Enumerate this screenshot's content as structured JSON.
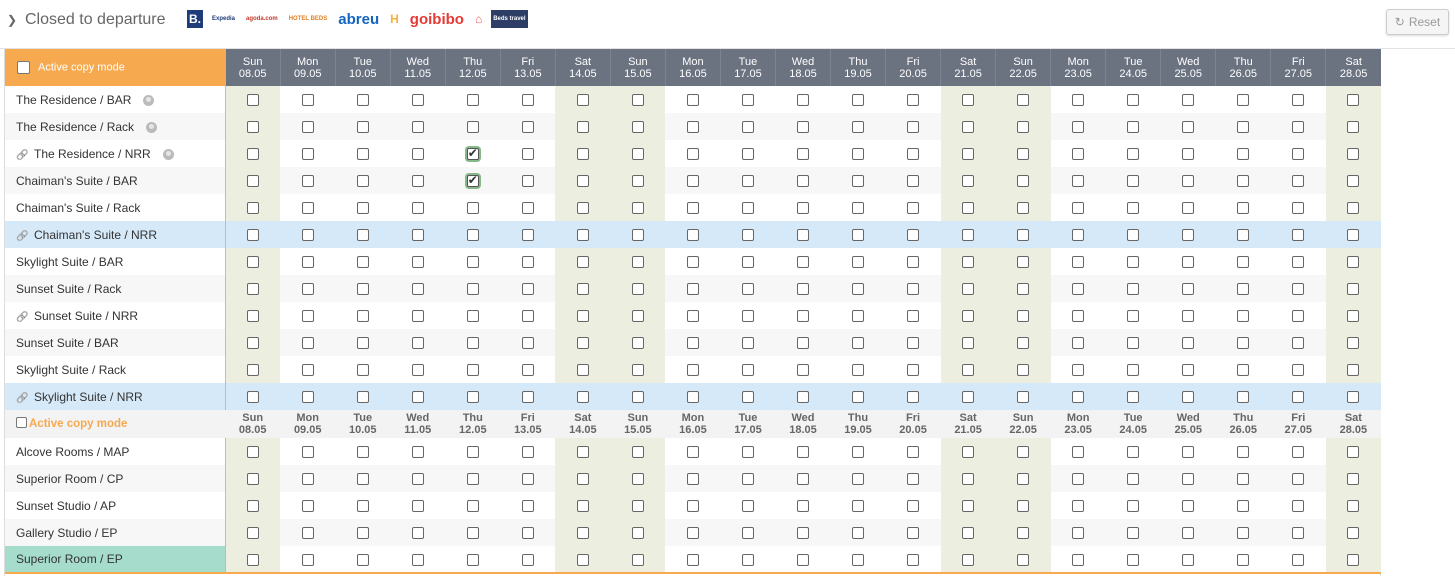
{
  "header": {
    "title": "Closed to departure",
    "reset_label": "Reset",
    "logos": [
      {
        "name": "booking-logo",
        "text": "B.",
        "color": "#ffffff",
        "bg": "#1f3c7a"
      },
      {
        "name": "expedia-logo",
        "text": "Expedia",
        "color": "#1f3c7a",
        "bg": "#ffffff"
      },
      {
        "name": "agoda-logo",
        "text": "agoda.com",
        "color": "#c0392b",
        "bg": "#ffffff"
      },
      {
        "name": "hotelbeds-logo",
        "text": "HOTEL BEDS",
        "color": "#e67e22",
        "bg": "#ffffff"
      },
      {
        "name": "abreu-logo",
        "text": "abreu",
        "color": "#1565c0",
        "bg": "#ffffff"
      },
      {
        "name": "hostelworld-logo",
        "text": "H",
        "color": "#f5b041",
        "bg": "#ffffff"
      },
      {
        "name": "goibibo-logo",
        "text": "goibibo",
        "color": "#e53935",
        "bg": "#ffffff"
      },
      {
        "name": "airbnb-logo",
        "text": "⌂",
        "color": "#ff5a5f",
        "bg": "#ffffff"
      },
      {
        "name": "bedsitravel-logo",
        "text": "Beds travel",
        "color": "#ffffff",
        "bg": "#2c3e66"
      }
    ]
  },
  "copy_mode_label": "Active copy mode",
  "dates": [
    {
      "day": "Sun",
      "date": "08.05",
      "weekend": true
    },
    {
      "day": "Mon",
      "date": "09.05",
      "weekend": false
    },
    {
      "day": "Tue",
      "date": "10.05",
      "weekend": false
    },
    {
      "day": "Wed",
      "date": "11.05",
      "weekend": false
    },
    {
      "day": "Thu",
      "date": "12.05",
      "weekend": false
    },
    {
      "day": "Fri",
      "date": "13.05",
      "weekend": false
    },
    {
      "day": "Sat",
      "date": "14.05",
      "weekend": true
    },
    {
      "day": "Sun",
      "date": "15.05",
      "weekend": true
    },
    {
      "day": "Mon",
      "date": "16.05",
      "weekend": false
    },
    {
      "day": "Tue",
      "date": "17.05",
      "weekend": false
    },
    {
      "day": "Wed",
      "date": "18.05",
      "weekend": false
    },
    {
      "day": "Thu",
      "date": "19.05",
      "weekend": false
    },
    {
      "day": "Fri",
      "date": "20.05",
      "weekend": false
    },
    {
      "day": "Sat",
      "date": "21.05",
      "weekend": true
    },
    {
      "day": "Sun",
      "date": "22.05",
      "weekend": true
    },
    {
      "day": "Mon",
      "date": "23.05",
      "weekend": false
    },
    {
      "day": "Tue",
      "date": "24.05",
      "weekend": false
    },
    {
      "day": "Wed",
      "date": "25.05",
      "weekend": false
    },
    {
      "day": "Thu",
      "date": "26.05",
      "weekend": false
    },
    {
      "day": "Fri",
      "date": "27.05",
      "weekend": false
    },
    {
      "day": "Sat",
      "date": "28.05",
      "weekend": true
    }
  ],
  "group1": [
    {
      "label": "The Residence / BAR",
      "link": false,
      "globe": true,
      "style": "",
      "checked": []
    },
    {
      "label": "The Residence / Rack",
      "link": false,
      "globe": true,
      "style": "",
      "checked": []
    },
    {
      "label": "The Residence / NRR",
      "link": true,
      "globe": true,
      "style": "",
      "checked": [
        4
      ]
    },
    {
      "label": "Chaiman's Suite / BAR",
      "link": false,
      "globe": false,
      "style": "",
      "checked": [
        4
      ]
    },
    {
      "label": "Chaiman's Suite / Rack",
      "link": false,
      "globe": false,
      "style": "",
      "checked": []
    },
    {
      "label": "Chaiman's Suite / NRR",
      "link": true,
      "globe": false,
      "style": "blue",
      "checked": []
    },
    {
      "label": "Skylight Suite / BAR",
      "link": false,
      "globe": false,
      "style": "",
      "checked": []
    },
    {
      "label": "Sunset Suite / Rack",
      "link": false,
      "globe": false,
      "style": "",
      "checked": []
    },
    {
      "label": "Sunset Suite / NRR",
      "link": true,
      "globe": false,
      "style": "",
      "checked": []
    },
    {
      "label": "Sunset Suite / BAR",
      "link": false,
      "globe": false,
      "style": "",
      "checked": []
    },
    {
      "label": "Skylight Suite / Rack",
      "link": false,
      "globe": false,
      "style": "",
      "checked": []
    },
    {
      "label": "Skylight Suite / NRR",
      "link": true,
      "globe": false,
      "style": "blue",
      "checked": []
    }
  ],
  "group2": [
    {
      "label": "Alcove Rooms / MAP",
      "link": false,
      "globe": false,
      "style": "",
      "checked": []
    },
    {
      "label": "Superior Room / CP",
      "link": false,
      "globe": false,
      "style": "",
      "checked": []
    },
    {
      "label": "Sunset Studio / AP",
      "link": false,
      "globe": false,
      "style": "",
      "checked": []
    },
    {
      "label": "Gallery Studio / EP",
      "link": false,
      "globe": false,
      "style": "",
      "checked": []
    },
    {
      "label": "Superior Room / EP",
      "link": false,
      "globe": false,
      "style": "teal",
      "checked": []
    }
  ]
}
